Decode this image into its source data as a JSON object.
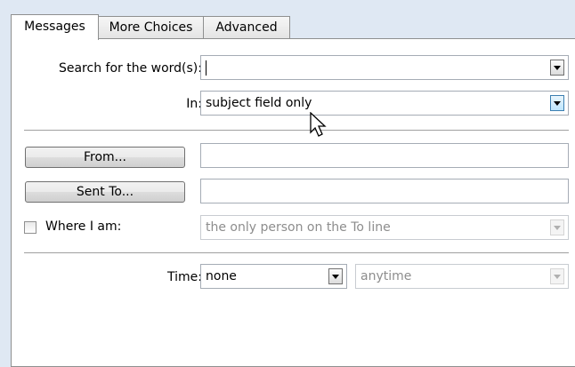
{
  "tabs": [
    {
      "label": "Messages"
    },
    {
      "label": "More Choices"
    },
    {
      "label": "Advanced"
    }
  ],
  "search": {
    "label": "Search for the word(s):",
    "value": ""
  },
  "in": {
    "label": "In:",
    "value": "subject field only"
  },
  "from_button": {
    "label": "From..."
  },
  "from_field": {
    "value": ""
  },
  "sent_to_button": {
    "label": "Sent To..."
  },
  "sent_to_field": {
    "value": ""
  },
  "where_i_am": {
    "label": "Where I am:",
    "checked": false,
    "value": "the only person on the To line"
  },
  "time": {
    "label": "Time:",
    "value": "none",
    "range_value": "anytime"
  },
  "icons": [
    "dropdown-arrow-icon",
    "mouse-pointer-icon",
    "checkbox-icon"
  ],
  "colors": {
    "background": "#dfe8f3",
    "panel": "#ffffff",
    "border": "#8e8f8f",
    "disabled_text": "#8d8d8d",
    "highlight": "#3c7fb1"
  }
}
